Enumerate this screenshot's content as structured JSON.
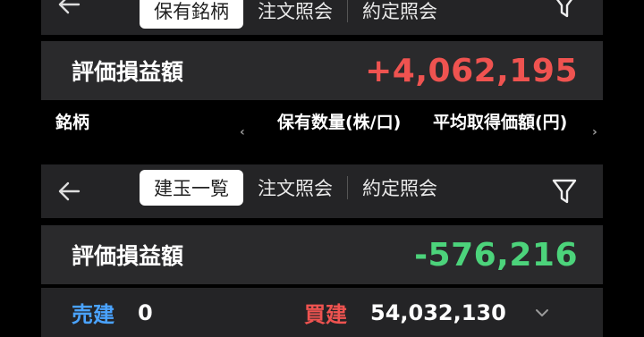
{
  "top_nav": {
    "tabs": [
      "保有銘柄",
      "注文照会",
      "約定照会"
    ],
    "active_index": 0
  },
  "pl_top": {
    "label": "評価損益額",
    "value": "+4,062,195"
  },
  "columns": {
    "name": "銘柄",
    "qty": "保有数量(株/口)",
    "avg": "平均取得価額(円)"
  },
  "second_nav": {
    "tabs": [
      "建玉一覧",
      "注文照会",
      "約定照会"
    ],
    "active_index": 0
  },
  "pl_bottom": {
    "label": "評価損益額",
    "value": "-576,216"
  },
  "summary": {
    "sell_label": "売建",
    "sell_value": "0",
    "buy_label": "買建",
    "buy_value": "54,032,130"
  },
  "colors": {
    "positive": "#ef5350",
    "negative": "#4cd37b",
    "sell": "#4aa3ff",
    "buy": "#ef5350"
  }
}
